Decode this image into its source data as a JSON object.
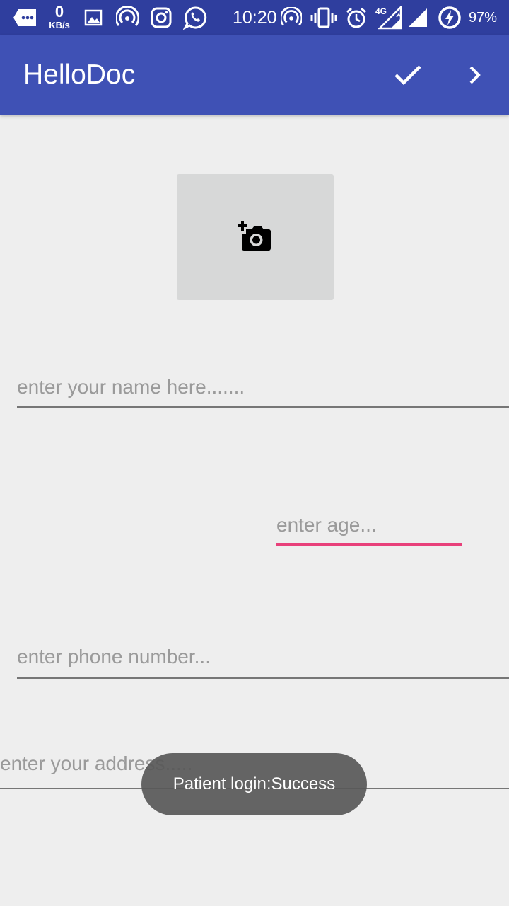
{
  "status_bar": {
    "net_speed_value": "0",
    "net_speed_unit": "KB/s",
    "time": "10:20",
    "network_type": "4G",
    "battery_percent": "97%",
    "icons": [
      "messages-icon",
      "gallery-icon",
      "hotspot-icon",
      "instagram-icon",
      "whatsapp-icon",
      "hotspot-icon",
      "vibrate-icon",
      "alarm-icon",
      "signal-4g-icon",
      "signal-icon",
      "battery-charging-icon"
    ]
  },
  "app_bar": {
    "title": "HelloDoc",
    "actions": [
      "check-icon",
      "chevron-right-icon"
    ]
  },
  "photo_picker": {
    "icon": "add-a-photo-icon"
  },
  "form": {
    "name_placeholder": "enter your name here.......",
    "age_placeholder": "enter age...",
    "phone_placeholder": "enter phone number...",
    "address_placeholder": "enter your address....."
  },
  "toast": {
    "message": "Patient login:Success"
  },
  "colors": {
    "status_bar": "#2f3e9e",
    "app_bar": "#3f51b5",
    "background": "#eeeeee",
    "accent": "#e8407a",
    "photo_box": "#d7d8d8"
  }
}
